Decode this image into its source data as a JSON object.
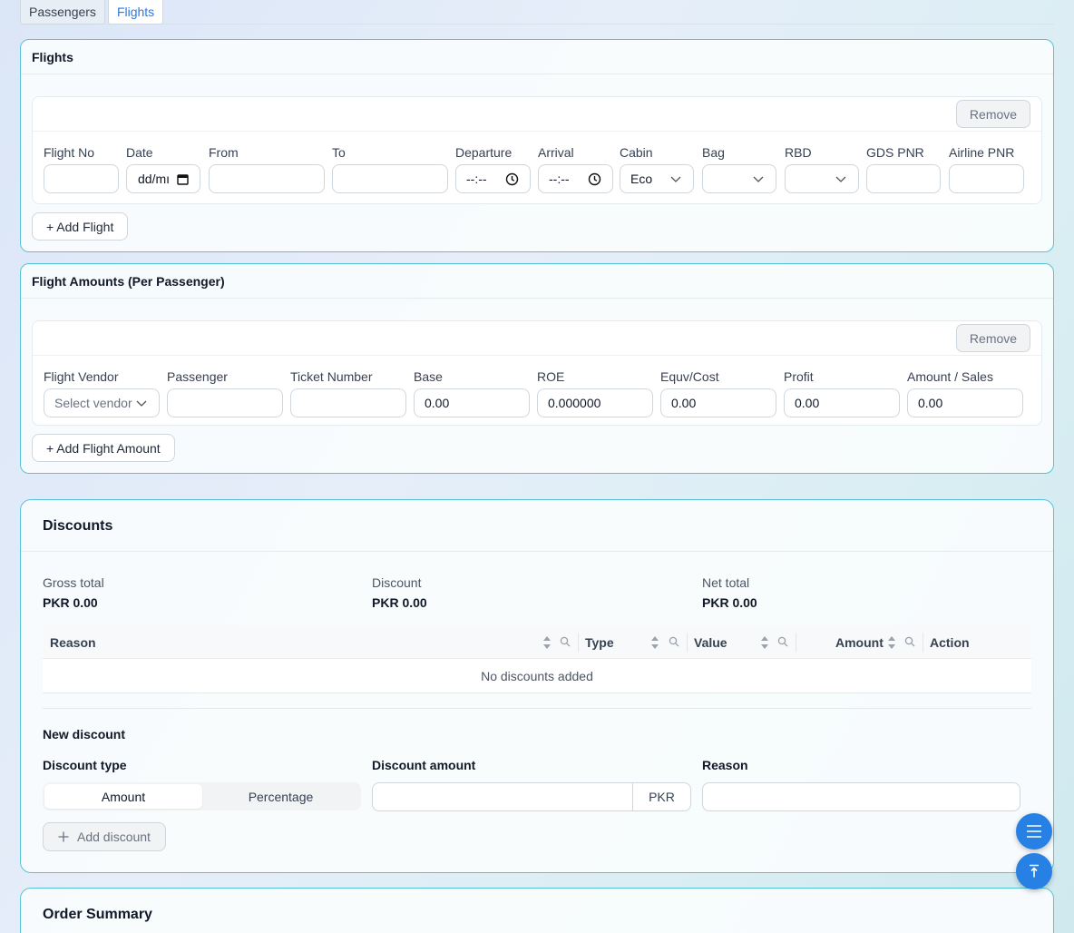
{
  "tabs": [
    {
      "label": "Passengers",
      "active": false
    },
    {
      "label": "Flights",
      "active": true
    }
  ],
  "flights_card": {
    "title": "Flights",
    "remove_label": "Remove",
    "fields": {
      "flight_no": {
        "label": "Flight No",
        "value": ""
      },
      "date": {
        "label": "Date",
        "value": "dd/mı"
      },
      "from": {
        "label": "From",
        "value": ""
      },
      "to": {
        "label": "To",
        "value": ""
      },
      "departure": {
        "label": "Departure",
        "value": "--:--"
      },
      "arrival": {
        "label": "Arrival",
        "value": "--:--"
      },
      "cabin": {
        "label": "Cabin",
        "value": "Eco"
      },
      "bag": {
        "label": "Bag",
        "value": ""
      },
      "rbd": {
        "label": "RBD",
        "value": ""
      },
      "gds_pnr": {
        "label": "GDS PNR",
        "value": ""
      },
      "airline_pnr": {
        "label": "Airline PNR",
        "value": ""
      }
    },
    "add_label": "+ Add Flight"
  },
  "amounts_card": {
    "title": "Flight Amounts (Per Passenger)",
    "remove_label": "Remove",
    "fields": {
      "vendor": {
        "label": "Flight Vendor",
        "placeholder": "Select vendor"
      },
      "passenger": {
        "label": "Passenger",
        "value": ""
      },
      "ticket": {
        "label": "Ticket Number",
        "value": ""
      },
      "base": {
        "label": "Base",
        "value": "0.00"
      },
      "roe": {
        "label": "ROE",
        "value": "0.000000"
      },
      "equv": {
        "label": "Equv/Cost",
        "value": "0.00"
      },
      "profit": {
        "label": "Profit",
        "value": "0.00"
      },
      "sales": {
        "label": "Amount / Sales",
        "value": "0.00"
      }
    },
    "add_label": "+ Add Flight Amount"
  },
  "discounts": {
    "title": "Discounts",
    "gross": {
      "label": "Gross total",
      "value": "PKR 0.00"
    },
    "discount": {
      "label": "Discount",
      "value": "PKR 0.00"
    },
    "net": {
      "label": "Net total",
      "value": "PKR 0.00"
    },
    "table": {
      "columns": [
        "Reason",
        "Type",
        "Value",
        "Amount",
        "Action"
      ],
      "empty_text": "No discounts added"
    },
    "new_title": "New discount",
    "type_label": "Discount type",
    "type_options": [
      "Amount",
      "Percentage"
    ],
    "type_selected": "Amount",
    "amount_label": "Discount amount",
    "amount_value": "",
    "currency": "PKR",
    "reason_label": "Reason",
    "reason_value": "",
    "add_label": "Add discount"
  },
  "order_summary": {
    "title": "Order Summary"
  },
  "colors": {
    "accent": "#2780e3",
    "card_border": "#57c4d4",
    "tab_active": "#2a7ae2"
  }
}
